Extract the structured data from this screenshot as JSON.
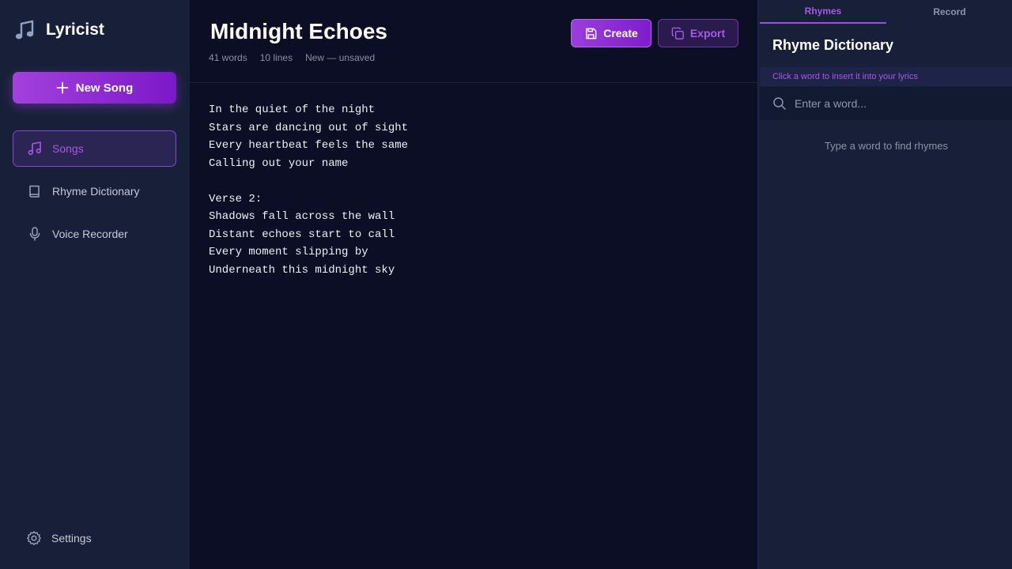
{
  "app": {
    "name": "Lyricist",
    "logo_icon": "music-note-icon"
  },
  "sidebar": {
    "new_song_label": "New Song",
    "items": [
      {
        "label": "Songs",
        "icon": "music-note-icon",
        "active": true
      },
      {
        "label": "Rhyme Dictionary",
        "icon": "book-icon",
        "active": false
      },
      {
        "label": "Voice Recorder",
        "icon": "microphone-icon",
        "active": false
      }
    ],
    "settings_label": "Settings"
  },
  "editor": {
    "title": "Midnight Echoes",
    "meta": {
      "words": "41 words",
      "lines": "10 lines",
      "status": "New — unsaved"
    },
    "create_label": "Create",
    "export_label": "Export",
    "lyrics": "In the quiet of the night\nStars are dancing out of sight\nEvery heartbeat feels the same\nCalling out your name\n\nVerse 2:\nShadows fall across the wall\nDistant echoes start to call\nEvery moment slipping by\nUnderneath this midnight sky"
  },
  "panel": {
    "tabs": [
      {
        "label": "Rhymes",
        "active": true
      },
      {
        "label": "Record",
        "active": false
      }
    ],
    "title": "Rhyme Dictionary",
    "hint": "Click a word to insert it into your lyrics",
    "search_placeholder": "Enter a word...",
    "empty_text": "Type a word to find rhymes"
  },
  "colors": {
    "accent": "#a957e8",
    "sidebar_bg": "#172038",
    "main_bg": "#0b0e24"
  }
}
